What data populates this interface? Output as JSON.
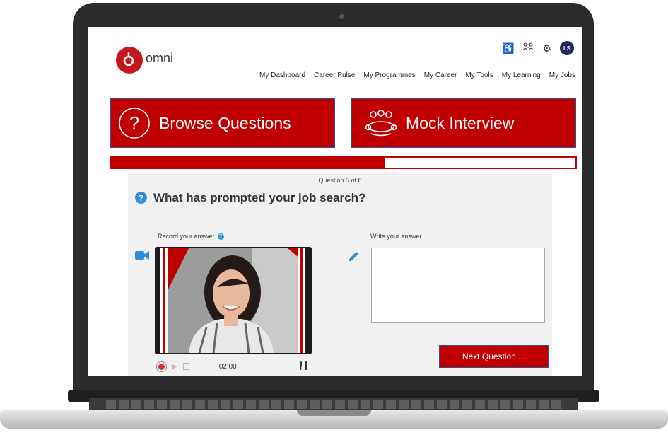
{
  "brand": {
    "name": "omni",
    "color": "#c4161c"
  },
  "header": {
    "icons": [
      "accessibility-icon",
      "people-icon",
      "gear-icon"
    ],
    "avatar_initials": "LS",
    "nav": [
      {
        "label": "My Dashboard"
      },
      {
        "label": "Career Pulse"
      },
      {
        "label": "My Programmes"
      },
      {
        "label": "My Career"
      },
      {
        "label": "My Tools"
      },
      {
        "label": "My Learning"
      },
      {
        "label": "My Jobs"
      }
    ]
  },
  "tiles": {
    "browse": {
      "label": "Browse Questions",
      "icon": "question-circle-icon"
    },
    "mock": {
      "label": "Mock Interview",
      "icon": "group-meeting-icon"
    }
  },
  "progress": {
    "fraction": 0.59
  },
  "question": {
    "counter": "Question 5 of 8",
    "text": "What has prompted your job search?"
  },
  "recorder": {
    "label": "Record your answer",
    "timer": "02:00"
  },
  "answer": {
    "label": "Write your answer",
    "value": ""
  },
  "next_button": {
    "label": "Next Question ..."
  },
  "colors": {
    "accent": "#c00000",
    "info": "#2f8fd8",
    "avatar": "#1f2a55"
  }
}
